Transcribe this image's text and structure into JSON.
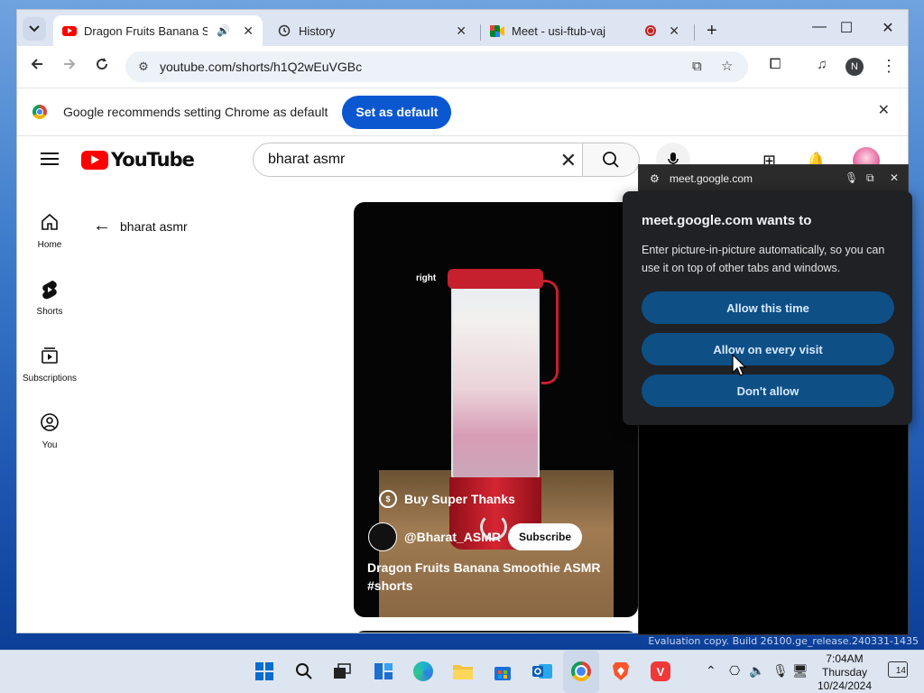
{
  "browser": {
    "tabs": [
      {
        "title": "Dragon Fruits Banana Smoo",
        "favicon": "youtube-icon",
        "active": true
      },
      {
        "title": "History",
        "favicon": "history-icon",
        "active": false
      },
      {
        "title": "Meet - usi-ftub-vaj",
        "favicon": "meet-icon",
        "active": false
      }
    ],
    "new_tab_label": "+",
    "url": "youtube.com/shorts/h1Q2wEuVGBc",
    "profile_initial": "N",
    "infobar": {
      "message": "Google recommends setting Chrome as default",
      "button_label": "Set as default"
    }
  },
  "youtube": {
    "logo_text": "YouTube",
    "search_query": "bharat asmr",
    "guide": [
      {
        "label": "Home",
        "icon": "home-icon"
      },
      {
        "label": "Shorts",
        "icon": "shorts-icon"
      },
      {
        "label": "Subscriptions",
        "icon": "subscriptions-icon"
      },
      {
        "label": "You",
        "icon": "you-icon"
      }
    ],
    "back_label": "bharat asmr",
    "short": {
      "overlay_text": "right",
      "super_thanks": "Buy Super Thanks",
      "channel": "@Bharat_ASMR",
      "subscribe": "Subscribe",
      "title": "Dragon Fruits Banana Smoothie ASMR #shorts"
    }
  },
  "pip": {
    "host": "meet.google.com"
  },
  "permission": {
    "title": "meet.google.com wants to",
    "description": "Enter picture-in-picture automatically, so you can use it on top of other tabs and windows.",
    "buttons": [
      "Allow this time",
      "Allow on every visit",
      "Don't allow"
    ]
  },
  "desktop": {
    "watermark": "Evaluation copy. Build 26100.ge_release.240331-1435"
  },
  "taskbar": {
    "time": "7:04AM",
    "day": "Thursday",
    "date": "10/24/2024",
    "notification_count": "14"
  },
  "colors": {
    "accent": "#0b57d0",
    "youtube_red": "#ff0000",
    "permission_button": "#0e4f86",
    "dialog_bg": "#202124"
  }
}
